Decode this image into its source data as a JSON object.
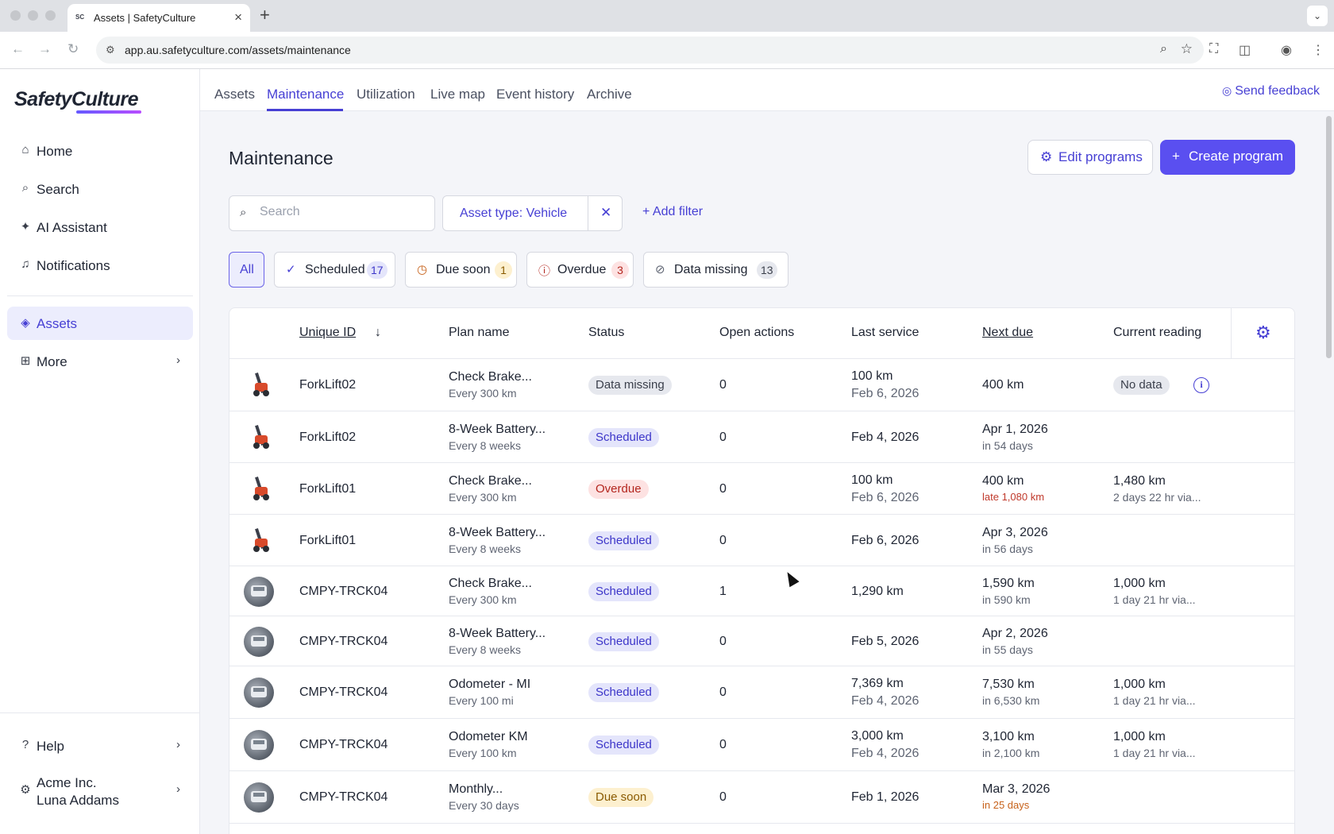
{
  "browser": {
    "tab_title": "Assets | SafetyCulture",
    "tab_favicon": "SC",
    "url": "app.au.safetyculture.com/assets/maintenance"
  },
  "sidebar": {
    "logo": "SafetyCulture",
    "items": [
      {
        "label": "Home",
        "icon": "home-icon"
      },
      {
        "label": "Search",
        "icon": "search-icon"
      },
      {
        "label": "AI Assistant",
        "icon": "sparkle-icon"
      },
      {
        "label": "Notifications",
        "icon": "bell-icon"
      },
      {
        "label": "Assets",
        "icon": "cube-icon",
        "active": true
      },
      {
        "label": "More",
        "icon": "grid-icon"
      }
    ],
    "help": "Help",
    "org_name": "Acme Inc.",
    "user_name": "Luna Addams"
  },
  "topnav": {
    "tabs": [
      "Assets",
      "Maintenance",
      "Utilization",
      "Live map",
      "Event history",
      "Archive"
    ],
    "active_tab": "Maintenance",
    "feedback": "Send feedback"
  },
  "page": {
    "title": "Maintenance",
    "edit_programs": "Edit programs",
    "create_program": "Create program",
    "search_placeholder": "Search",
    "filter_chip": "Asset type: Vehicle",
    "add_filter": "Add filter"
  },
  "segments": {
    "all": "All",
    "scheduled": {
      "label": "Scheduled",
      "count": "17"
    },
    "due_soon": {
      "label": "Due soon",
      "count": "1"
    },
    "overdue": {
      "label": "Overdue",
      "count": "3"
    },
    "data_missing": {
      "label": "Data missing",
      "count": "13"
    }
  },
  "table": {
    "columns": [
      "Unique ID",
      "Plan name",
      "Status",
      "Open actions",
      "Last service",
      "Next due",
      "Current reading"
    ],
    "rows": [
      {
        "id": "ForkLift02",
        "plan": "Check Brake...",
        "plan_sub": "Every 300 km",
        "status": "Data missing",
        "actions": "0",
        "last": "100 km",
        "last_sub": "Feb 6, 2026",
        "next": "400 km",
        "next_sub": "",
        "reading": "No data",
        "reading_sub": ""
      },
      {
        "id": "ForkLift02",
        "plan": "8-Week Battery...",
        "plan_sub": "Every 8 weeks",
        "status": "Scheduled",
        "actions": "0",
        "last": "Feb 4, 2026",
        "last_sub": "",
        "next": "Apr 1, 2026",
        "next_sub": "in 54 days",
        "reading": "",
        "reading_sub": ""
      },
      {
        "id": "ForkLift01",
        "plan": "Check Brake...",
        "plan_sub": "Every 300 km",
        "status": "Overdue",
        "actions": "0",
        "last": "100 km",
        "last_sub": "Feb 6, 2026",
        "next": "400 km",
        "next_sub": "late 1,080 km",
        "reading": "1,480 km",
        "reading_sub": "2 days 22 hr via..."
      },
      {
        "id": "ForkLift01",
        "plan": "8-Week Battery...",
        "plan_sub": "Every 8 weeks",
        "status": "Scheduled",
        "actions": "0",
        "last": "Feb 6, 2026",
        "last_sub": "",
        "next": "Apr 3, 2026",
        "next_sub": "in 56 days",
        "reading": "",
        "reading_sub": ""
      },
      {
        "id": "CMPY-TRCK04",
        "plan": "Check Brake...",
        "plan_sub": "Every 300 km",
        "status": "Scheduled",
        "actions": "1",
        "last": "1,290 km",
        "last_sub": "",
        "next": "1,590 km",
        "next_sub": "in 590 km",
        "reading": "1,000 km",
        "reading_sub": "1 day 21 hr via..."
      },
      {
        "id": "CMPY-TRCK04",
        "plan": "8-Week Battery...",
        "plan_sub": "Every 8 weeks",
        "status": "Scheduled",
        "actions": "0",
        "last": "Feb 5, 2026",
        "last_sub": "",
        "next": "Apr 2, 2026",
        "next_sub": "in 55 days",
        "reading": "",
        "reading_sub": ""
      },
      {
        "id": "CMPY-TRCK04",
        "plan": "Odometer - MI",
        "plan_sub": "Every 100 mi",
        "status": "Scheduled",
        "actions": "0",
        "last": "7,369 km",
        "last_sub": "Feb 4, 2026",
        "next": "7,530 km",
        "next_sub": "in 6,530 km",
        "reading": "1,000 km",
        "reading_sub": "1 day 21 hr via..."
      },
      {
        "id": "CMPY-TRCK04",
        "plan": "Odometer KM",
        "plan_sub": "Every 100 km",
        "status": "Scheduled",
        "actions": "0",
        "last": "3,000 km",
        "last_sub": "Feb 4, 2026",
        "next": "3,100 km",
        "next_sub": "in 2,100 km",
        "reading": "1,000 km",
        "reading_sub": "1 day 21 hr via..."
      },
      {
        "id": "CMPY-TRCK04",
        "plan": "Monthly...",
        "plan_sub": "Every 30 days",
        "status": "Due soon",
        "actions": "0",
        "last": "Feb 1, 2026",
        "last_sub": "",
        "next": "Mar 3, 2026",
        "next_sub": "in 25 days",
        "reading": "",
        "reading_sub": ""
      }
    ]
  },
  "colors": {
    "accent": "#4740d4",
    "primary_button": "#5a4ff0",
    "scheduled_bg": "#e4e5fb",
    "scheduled_fg": "#3d36c9",
    "overdue_bg": "#fde2e2",
    "overdue_fg": "#b3261e",
    "due_soon_bg": "#fdf0cf",
    "due_soon_fg": "#8a5a00",
    "data_missing_bg": "#e6e8ee",
    "data_missing_fg": "#3a3f4b"
  }
}
